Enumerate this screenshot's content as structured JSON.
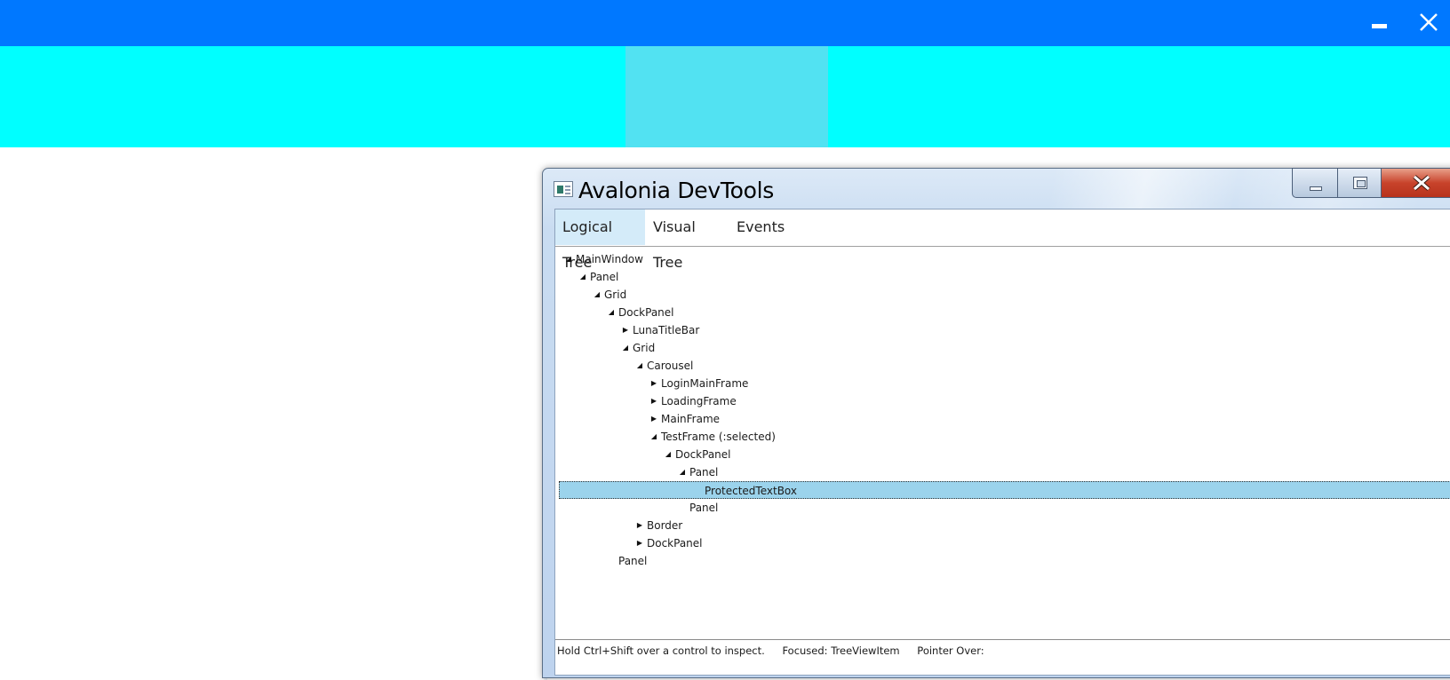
{
  "app": {
    "colors": {
      "titlebar": "#0078ff",
      "band": "#00ffff",
      "band_block": "#52e2f2"
    }
  },
  "devtools": {
    "title": "Avalonia DevTools",
    "tabs": [
      {
        "label": "Logical Tree",
        "selected": true
      },
      {
        "label": "Visual Tree",
        "selected": false
      },
      {
        "label": "Events",
        "selected": false
      }
    ],
    "tree": [
      {
        "label": "MainWindow",
        "depth": 0,
        "state": "expanded"
      },
      {
        "label": "Panel",
        "depth": 1,
        "state": "expanded"
      },
      {
        "label": "Grid",
        "depth": 2,
        "state": "expanded"
      },
      {
        "label": "DockPanel",
        "depth": 3,
        "state": "expanded"
      },
      {
        "label": "LunaTitleBar",
        "depth": 4,
        "state": "collapsed"
      },
      {
        "label": "Grid",
        "depth": 4,
        "state": "expanded"
      },
      {
        "label": "Carousel",
        "depth": 5,
        "state": "expanded"
      },
      {
        "label": "LoginMainFrame",
        "depth": 6,
        "state": "collapsed"
      },
      {
        "label": "LoadingFrame",
        "depth": 6,
        "state": "collapsed"
      },
      {
        "label": "MainFrame",
        "depth": 6,
        "state": "collapsed"
      },
      {
        "label": "TestFrame   (:selected)",
        "depth": 6,
        "state": "expanded"
      },
      {
        "label": "DockPanel",
        "depth": 7,
        "state": "expanded"
      },
      {
        "label": "Panel",
        "depth": 8,
        "state": "expanded"
      },
      {
        "label": "ProtectedTextBox",
        "depth": 9,
        "state": "leaf",
        "selected": true
      },
      {
        "label": "Panel",
        "depth": 8,
        "state": "leaf"
      },
      {
        "label": "Border",
        "depth": 5,
        "state": "collapsed"
      },
      {
        "label": "DockPanel",
        "depth": 5,
        "state": "collapsed"
      },
      {
        "label": "Panel",
        "depth": 3,
        "state": "leaf"
      }
    ],
    "status": {
      "hint": "Hold Ctrl+Shift over a control to inspect.",
      "focused": "Focused: TreeViewItem",
      "pointer_over": "Pointer Over:"
    }
  }
}
